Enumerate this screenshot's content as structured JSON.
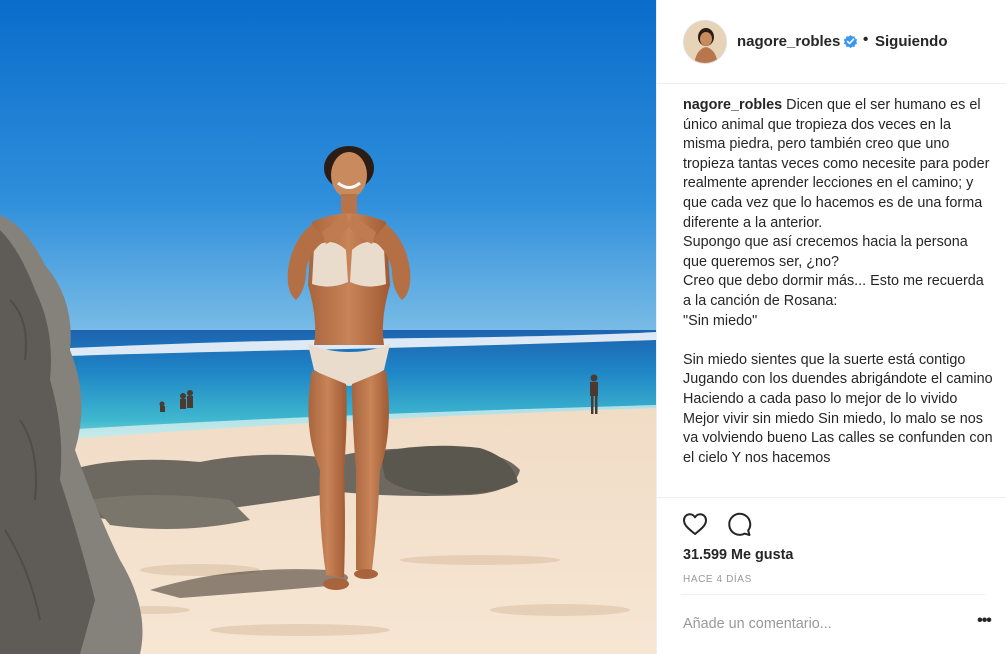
{
  "post": {
    "username": "nagore_robles",
    "follow_status": "Siguiendo",
    "separator": "•",
    "caption_text": "Dicen que el ser humano es el único animal que tropieza dos veces en la misma piedra, pero también creo que uno tropieza tantas veces como necesite para poder realmente aprender lecciones en el camino; y que cada vez que lo hacemos es de una forma diferente a la anterior.\nSupongo que así crecemos hacia la persona que queremos ser, ¿no?\nCreo que debo dormir más... Esto me recuerda a la canción de Rosana:\n\"Sin miedo\"\n\nSin miedo sientes que la suerte está contigo Jugando con los duendes abrigándote el camino Haciendo a cada paso lo mejor de lo vivido Mejor vivir sin miedo Sin miedo, lo malo se nos va volviendo bueno Las calles se confunden con el cielo Y nos hacemos",
    "likes": "31.599 Me gusta",
    "time_ago": "HACE 4 DÍAS",
    "comment_placeholder": "Añade un comentario...",
    "more_label": "•••"
  },
  "icons": {
    "verified": "verified-badge-icon",
    "like": "heart-outline-icon",
    "comment": "speech-bubble-icon",
    "more": "ellipsis-icon"
  },
  "colors": {
    "verified_blue": "#3897f0",
    "text": "#262626",
    "muted": "#999999",
    "divider": "#efefef"
  }
}
